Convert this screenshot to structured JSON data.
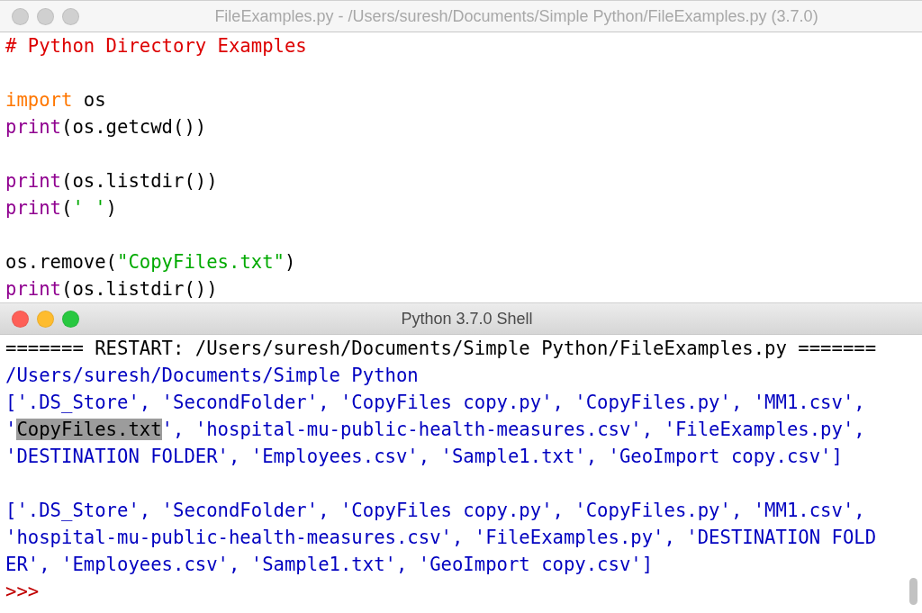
{
  "editor": {
    "title": "FileExamples.py - /Users/suresh/Documents/Simple Python/FileExamples.py (3.7.0)",
    "active": false,
    "lines": [
      {
        "kind": "code",
        "tokens": [
          {
            "text": "# Python Directory Examples",
            "kind": "comment"
          }
        ]
      },
      {
        "kind": "blank"
      },
      {
        "kind": "code",
        "tokens": [
          {
            "text": "import",
            "kind": "keyword"
          },
          {
            "text": " os",
            "kind": "plain"
          }
        ]
      },
      {
        "kind": "code",
        "tokens": [
          {
            "text": "print",
            "kind": "builtin"
          },
          {
            "text": "(os.getcwd())",
            "kind": "plain"
          }
        ]
      },
      {
        "kind": "blank"
      },
      {
        "kind": "code",
        "tokens": [
          {
            "text": "print",
            "kind": "builtin"
          },
          {
            "text": "(os.listdir())",
            "kind": "plain"
          }
        ]
      },
      {
        "kind": "code",
        "tokens": [
          {
            "text": "print",
            "kind": "builtin"
          },
          {
            "text": "(",
            "kind": "plain"
          },
          {
            "text": "' '",
            "kind": "string"
          },
          {
            "text": ")",
            "kind": "plain"
          }
        ]
      },
      {
        "kind": "blank"
      },
      {
        "kind": "code",
        "tokens": [
          {
            "text": "os.remove(",
            "kind": "plain"
          },
          {
            "text": "\"CopyFiles.txt\"",
            "kind": "string"
          },
          {
            "text": ")",
            "kind": "plain"
          }
        ]
      },
      {
        "kind": "code",
        "tokens": [
          {
            "text": "print",
            "kind": "builtin"
          },
          {
            "text": "(os.listdir())",
            "kind": "plain"
          }
        ]
      }
    ]
  },
  "shell": {
    "title": "Python 3.7.0 Shell",
    "active": true,
    "lines": [
      {
        "kind": "code",
        "tokens": [
          {
            "text": "======= RESTART: /Users/suresh/Documents/Simple Python/FileExamples.py =======",
            "kind": "restart"
          }
        ]
      },
      {
        "kind": "code",
        "tokens": [
          {
            "text": "/Users/suresh/Documents/Simple Python",
            "kind": "output"
          }
        ]
      },
      {
        "kind": "code",
        "tokens": [
          {
            "text": "['.DS_Store', 'SecondFolder', 'CopyFiles copy.py', 'CopyFiles.py', 'MM1.csv',",
            "kind": "output"
          }
        ]
      },
      {
        "kind": "code",
        "tokens": [
          {
            "text": "'",
            "kind": "output"
          },
          {
            "text": "CopyFiles.txt",
            "kind": "selection"
          },
          {
            "text": "', 'hospital-mu-public-health-measures.csv', 'FileExamples.py',",
            "kind": "output"
          }
        ]
      },
      {
        "kind": "code",
        "tokens": [
          {
            "text": "'DESTINATION FOLDER', 'Employees.csv', 'Sample1.txt', 'GeoImport copy.csv']",
            "kind": "output"
          }
        ]
      },
      {
        "kind": "blank"
      },
      {
        "kind": "code",
        "tokens": [
          {
            "text": "['.DS_Store', 'SecondFolder', 'CopyFiles copy.py', 'CopyFiles.py', 'MM1.csv',",
            "kind": "output"
          }
        ]
      },
      {
        "kind": "code",
        "tokens": [
          {
            "text": "'hospital-mu-public-health-measures.csv', 'FileExamples.py', 'DESTINATION FOLD",
            "kind": "output"
          }
        ]
      },
      {
        "kind": "code",
        "tokens": [
          {
            "text": "ER', 'Employees.csv', 'Sample1.txt', 'GeoImport copy.csv']",
            "kind": "output"
          }
        ]
      },
      {
        "kind": "code",
        "tokens": [
          {
            "text": ">>>",
            "kind": "prompt"
          }
        ]
      }
    ]
  }
}
